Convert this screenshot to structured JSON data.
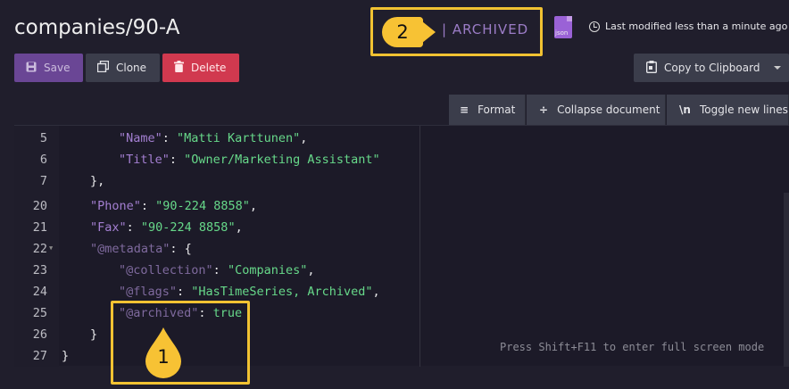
{
  "header": {
    "title": "companies/90-A",
    "archived_label": "| ARCHIVED",
    "json_icon_label": "json",
    "last_modified": "Last modified less than a minute ago"
  },
  "actions": {
    "save": "Save",
    "clone": "Clone",
    "delete": "Delete",
    "copy": "Copy to Clipboard"
  },
  "toolbar": {
    "format": "Format",
    "collapse": "Collapse document",
    "toggle": "Toggle new lines"
  },
  "editor": {
    "lines": [
      {
        "num": "5",
        "indent": 2,
        "key": "\"Name\"",
        "value": "\"Matti Karttunen\"",
        "trail": ","
      },
      {
        "num": "6",
        "indent": 2,
        "key": "\"Title\"",
        "value": "\"Owner/Marketing Assistant\"",
        "trail": ""
      },
      {
        "num": "7",
        "indent": 1,
        "text": "},"
      },
      {
        "num": "20",
        "indent": 1,
        "key": "\"Phone\"",
        "value": "\"90-224 8858\"",
        "trail": ","
      },
      {
        "num": "21",
        "indent": 1,
        "key": "\"Fax\"",
        "value": "\"90-224 8858\"",
        "trail": ","
      },
      {
        "num": "22",
        "indent": 1,
        "key": "\"@metadata\"",
        "text_after": ": {"
      },
      {
        "num": "23",
        "indent": 2,
        "key": "\"@collection\"",
        "value": "\"Companies\"",
        "trail": ","
      },
      {
        "num": "24",
        "indent": 2,
        "key": "\"@flags\"",
        "value": "\"HasTimeSeries, Archived\"",
        "trail": ","
      },
      {
        "num": "25",
        "indent": 2,
        "key": "\"@archived\"",
        "bool": "true"
      },
      {
        "num": "26",
        "indent": 1,
        "text": "}"
      },
      {
        "num": "27",
        "indent": 0,
        "text": "}"
      }
    ],
    "fullscreen_hint": "Press Shift+F11 to enter full screen mode"
  },
  "callouts": {
    "one": "1",
    "two": "2"
  },
  "colors": {
    "accent": "#6a4695",
    "danger": "#d1394f",
    "highlight": "#f1c232",
    "string": "#67d98a",
    "key": "#a37fd1"
  }
}
